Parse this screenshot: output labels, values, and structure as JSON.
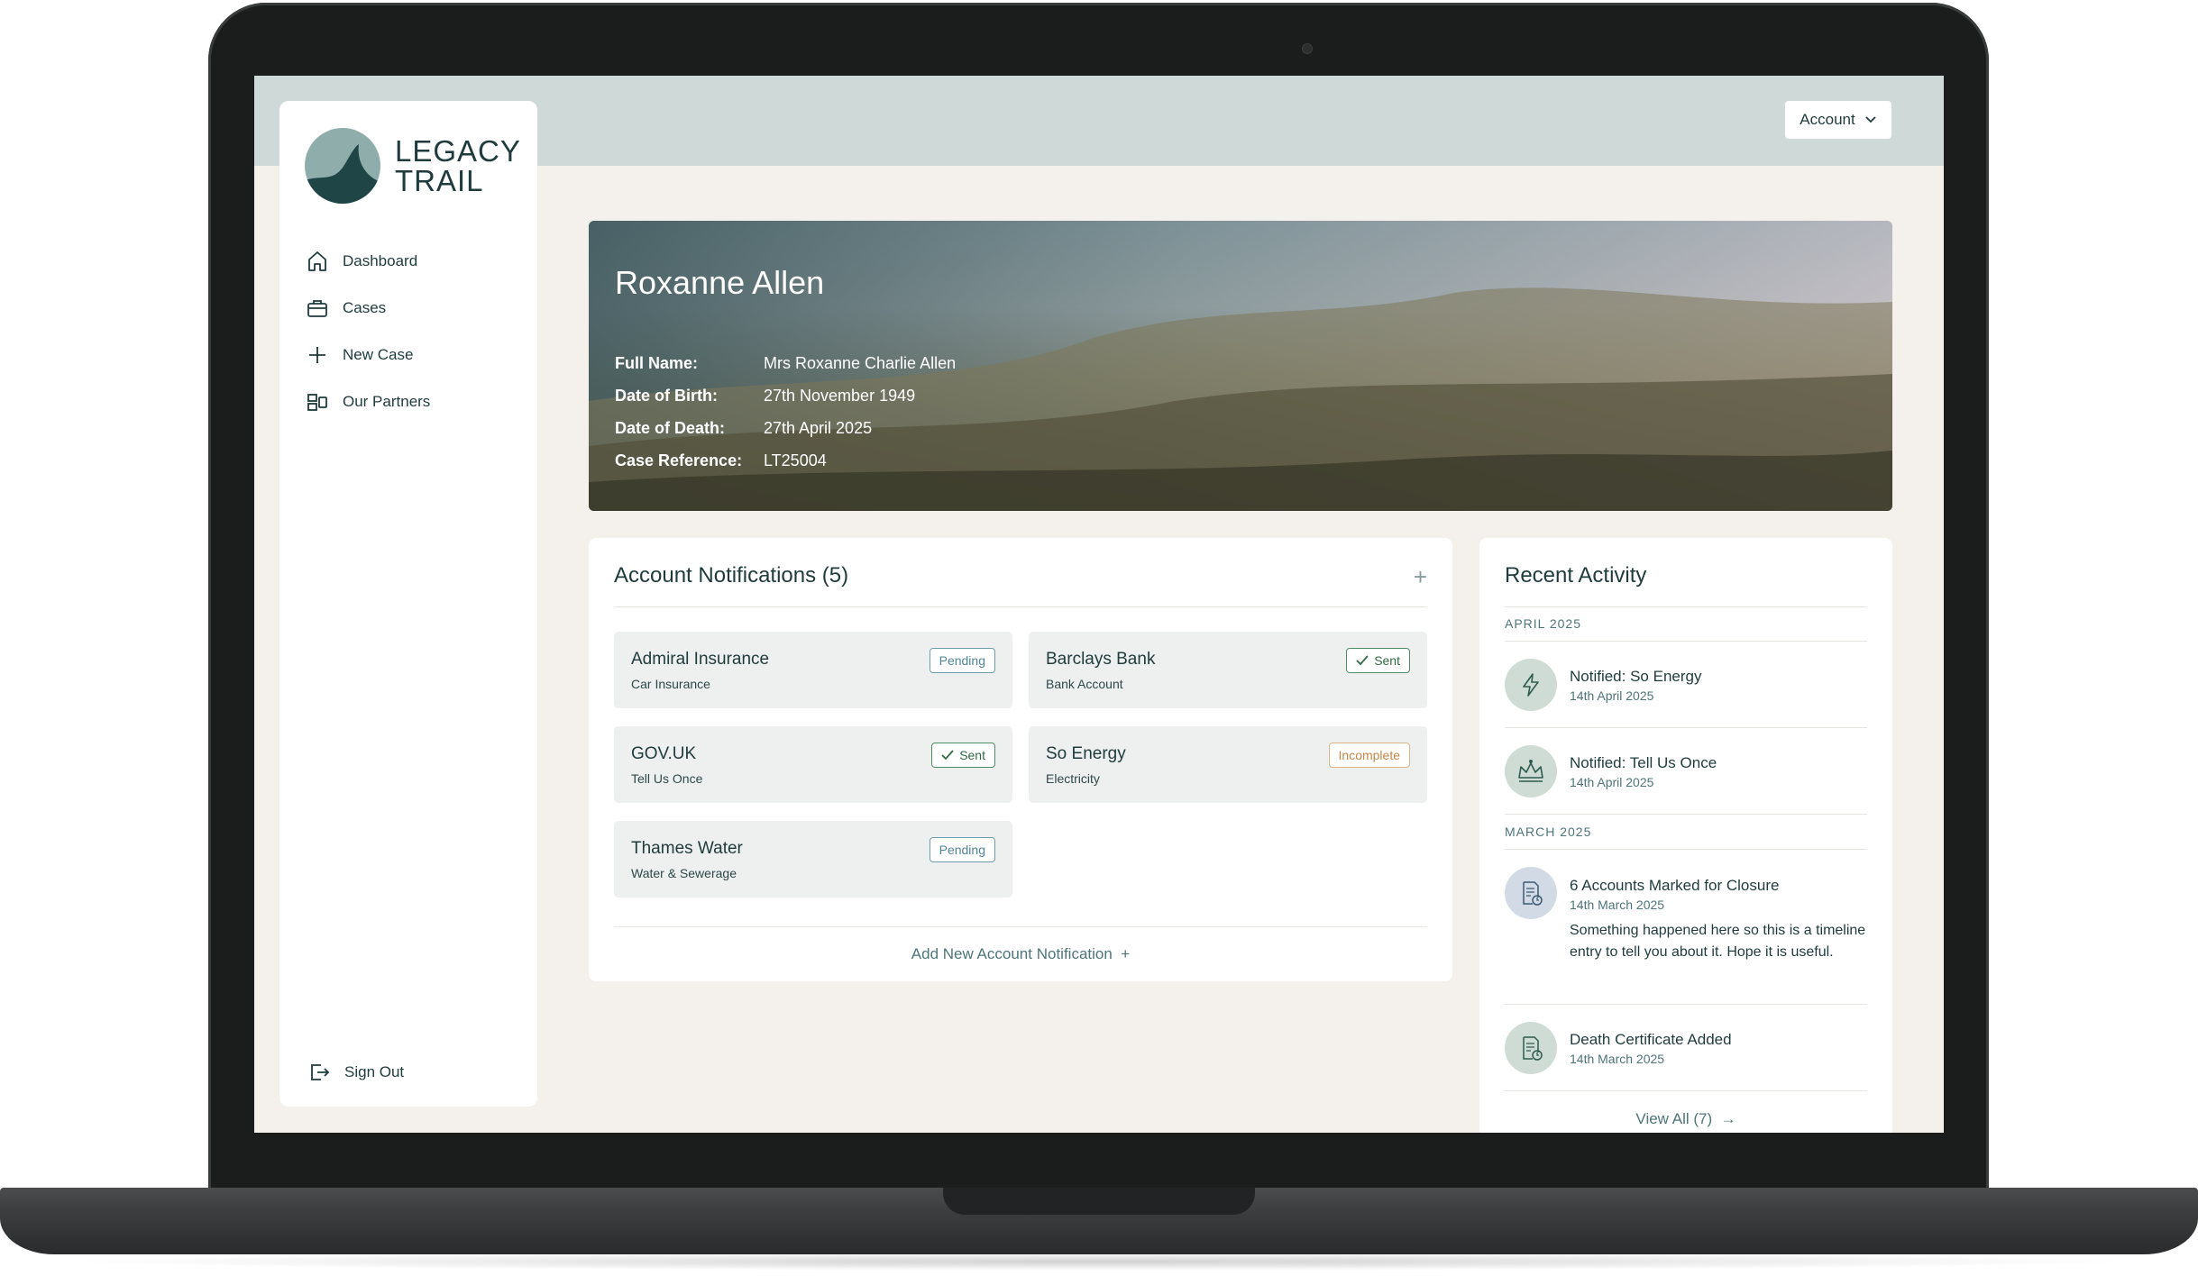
{
  "header": {
    "account_label": "Account"
  },
  "brand": {
    "line1": "LEGACY",
    "line2": "TRAIL"
  },
  "nav": {
    "items": [
      {
        "label": "Dashboard",
        "icon": "home-icon"
      },
      {
        "label": "Cases",
        "icon": "briefcase-icon"
      },
      {
        "label": "New Case",
        "icon": "plus-icon"
      },
      {
        "label": "Our Partners",
        "icon": "partners-icon"
      }
    ],
    "signout": "Sign Out"
  },
  "profile": {
    "name": "Roxanne Allen",
    "fields": [
      {
        "label": "Full Name:",
        "value": "Mrs Roxanne Charlie Allen"
      },
      {
        "label": "Date of Birth:",
        "value": "27th November 1949"
      },
      {
        "label": "Date of Death:",
        "value": "27th April 2025"
      },
      {
        "label": "Case Reference:",
        "value": "LT25004"
      }
    ]
  },
  "notifications": {
    "title": "Account Notifications (5)",
    "add_label": "Add New Account Notification",
    "items": [
      {
        "name": "Admiral Insurance",
        "type": "Car Insurance",
        "status": "Pending"
      },
      {
        "name": "Barclays Bank",
        "type": "Bank Account",
        "status": "Sent"
      },
      {
        "name": "GOV.UK",
        "type": "Tell Us Once",
        "status": "Sent"
      },
      {
        "name": "So Energy",
        "type": "Electricity",
        "status": "Incomplete"
      },
      {
        "name": "Thames Water",
        "type": "Water & Sewerage",
        "status": "Pending"
      }
    ]
  },
  "activity": {
    "title": "Recent Activity",
    "months": [
      "APRIL 2025",
      "MARCH 2025"
    ],
    "entries": [
      {
        "title": "Notified: So Energy",
        "date": "14th April 2025",
        "icon": "lightning-icon"
      },
      {
        "title": "Notified: Tell Us Once",
        "date": "14th April 2025",
        "icon": "crown-icon"
      },
      {
        "title": "6 Accounts Marked for Closure",
        "date": "14th March 2025",
        "icon": "document-clock-icon",
        "desc": "Something happened here so this is a timeline entry to tell you about it. Hope it is useful."
      },
      {
        "title": "Death Certificate Added",
        "date": "14th March 2025",
        "icon": "document-clock-icon"
      }
    ],
    "view_all": "View All (7)"
  },
  "colors": {
    "accent": "#1f3b3c",
    "sent": "#2f6a45",
    "pending": "#4f8596",
    "incomplete": "#c78646"
  }
}
